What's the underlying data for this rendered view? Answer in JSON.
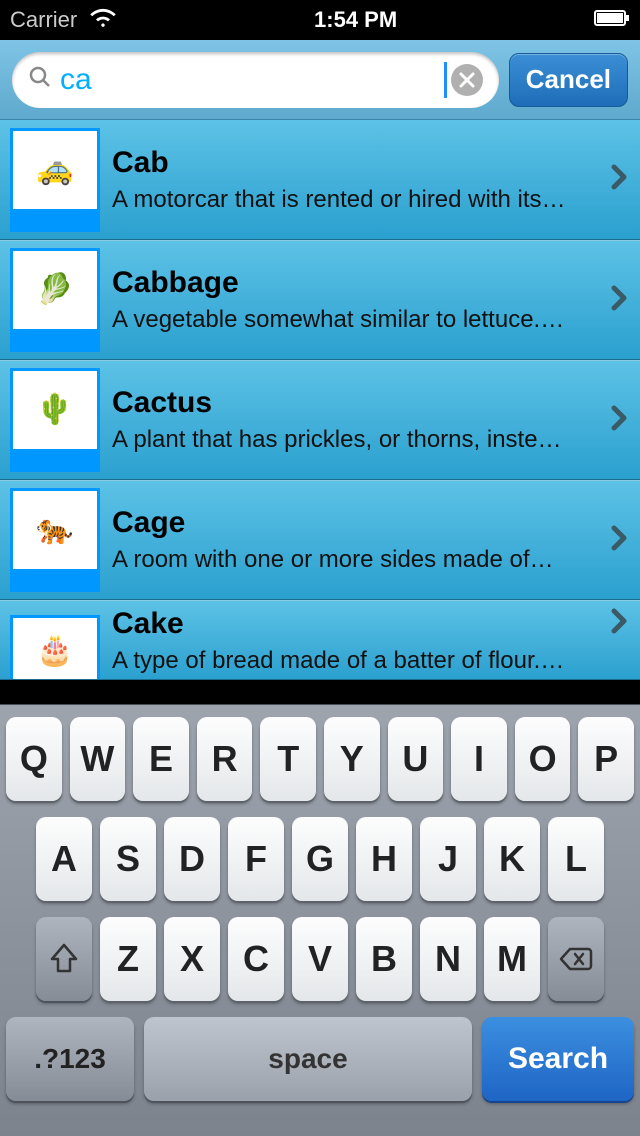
{
  "status": {
    "carrier": "Carrier",
    "time": "1:54 PM"
  },
  "search": {
    "value": "ca",
    "cancel_label": "Cancel"
  },
  "results": [
    {
      "title": "Cab",
      "desc": "A motorcar that is rented or hired with its…",
      "emoji": "🚕"
    },
    {
      "title": "Cabbage",
      "desc": "A vegetable somewhat similar to lettuce.…",
      "emoji": "🥬"
    },
    {
      "title": "Cactus",
      "desc": "A plant that has prickles, or thorns, inste…",
      "emoji": "🌵"
    },
    {
      "title": "Cage",
      "desc": "A room with one or more sides made of…",
      "emoji": "🐅"
    },
    {
      "title": "Cake",
      "desc": "A type of bread made of a batter of flour.…",
      "emoji": "🎂"
    }
  ],
  "keyboard": {
    "row1": [
      "Q",
      "W",
      "E",
      "R",
      "T",
      "Y",
      "U",
      "I",
      "O",
      "P"
    ],
    "row2": [
      "A",
      "S",
      "D",
      "F",
      "G",
      "H",
      "J",
      "K",
      "L"
    ],
    "row3": [
      "Z",
      "X",
      "C",
      "V",
      "B",
      "N",
      "M"
    ],
    "mode_label": ".?123",
    "space_label": "space",
    "search_label": "Search"
  }
}
